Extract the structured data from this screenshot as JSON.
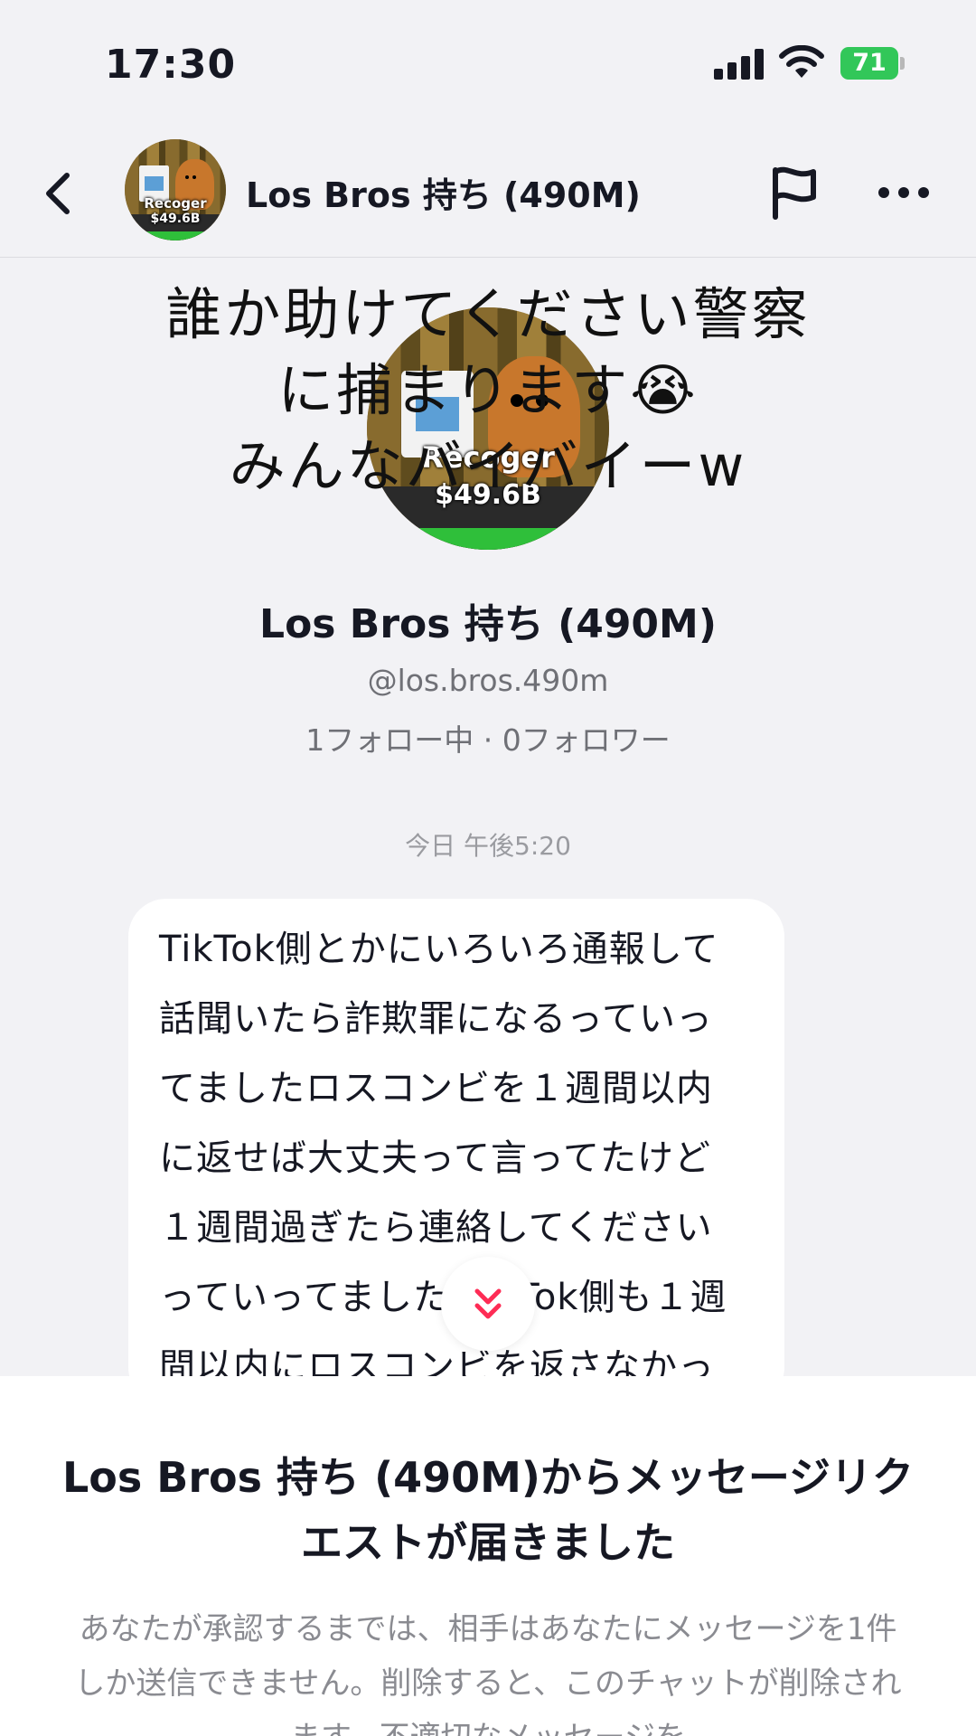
{
  "status_bar": {
    "time": "17:30",
    "battery": "71",
    "battery_color": "#32c759"
  },
  "header": {
    "title": "Los Bros 持ち (490M)",
    "back_icon": "chevron-left-icon",
    "flag_icon": "flag-icon",
    "more_icon": "more-horizontal-icon"
  },
  "avatar": {
    "label_top": "Recoger",
    "label_bottom": "$49.6B"
  },
  "overlay": {
    "lines": [
      "誰か助けてください警察",
      "に捕まります😭",
      "みんなバイバイーw"
    ]
  },
  "profile": {
    "name": "Los Bros 持ち (490M)",
    "handle": "@los.bros.490m",
    "stats": "1フォロー中 · 0フォロワー"
  },
  "conversation": {
    "timestamp": "今日 午後5:20",
    "message": "TikTok側とかにいろいろ通報して\n話聞いたら詐欺罪になるっていっ\nてましたロスコンビを１週間以内\nに返せば大丈夫って言ってたけど\n１週間過ぎたら連絡してください\nっていってました TikTok側も１週\n間以内にロスコンビを返さなかっ"
  },
  "request_sheet": {
    "title": "Los Bros 持ち (490M)からメッセージリクエストが届きました",
    "description": "あなたが承認するまでは、相手はあなたにメッセージを1件しか送信できません。削除すると、このチャットが削除されます。不適切なメッセージを"
  },
  "colors": {
    "accent": "#fe2c55",
    "background": "#f2f2f5",
    "bubble": "#ffffff"
  }
}
